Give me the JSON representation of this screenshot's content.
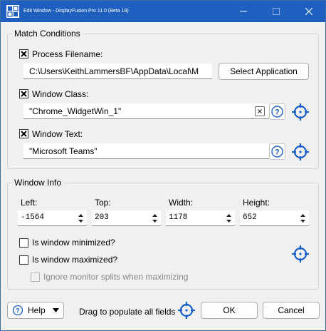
{
  "window": {
    "title": "Edit Window - DisplayFusion Pro 11.0 (Beta 19)"
  },
  "match_conditions": {
    "group_title": "Match Conditions",
    "process_filename": {
      "label": "Process Filename:",
      "checked": true,
      "value": "C:\\Users\\KeithLammersBF\\AppData\\Local\\M",
      "button": "Select Application"
    },
    "window_class": {
      "label": "Window Class:",
      "checked": true,
      "value": "\"Chrome_WidgetWin_1\""
    },
    "window_text": {
      "label": "Window Text:",
      "checked": true,
      "value": "\"Microsoft Teams\""
    }
  },
  "window_info": {
    "group_title": "Window Info",
    "left": {
      "label": "Left:",
      "value": "-1564"
    },
    "top": {
      "label": "Top:",
      "value": "203"
    },
    "width": {
      "label": "Width:",
      "value": "1178"
    },
    "height": {
      "label": "Height:",
      "value": "652"
    },
    "is_minimized": {
      "label": "Is window minimized?",
      "checked": false
    },
    "is_maximized": {
      "label": "Is window maximized?",
      "checked": false
    },
    "ignore_splits": {
      "label": "Ignore monitor splits when maximizing",
      "checked": false,
      "enabled": false
    }
  },
  "footer": {
    "help": "Help",
    "drag_text": "Drag to populate all fields",
    "ok": "OK",
    "cancel": "Cancel"
  },
  "icons": {
    "app": "displayfusion-app-icon",
    "crosshair": "crosshair-target-icon",
    "help": "question-circle-icon",
    "clear": "clear-x-icon"
  },
  "colors": {
    "titlebar": "#1f5fbf",
    "accent": "#1a5fc9"
  }
}
